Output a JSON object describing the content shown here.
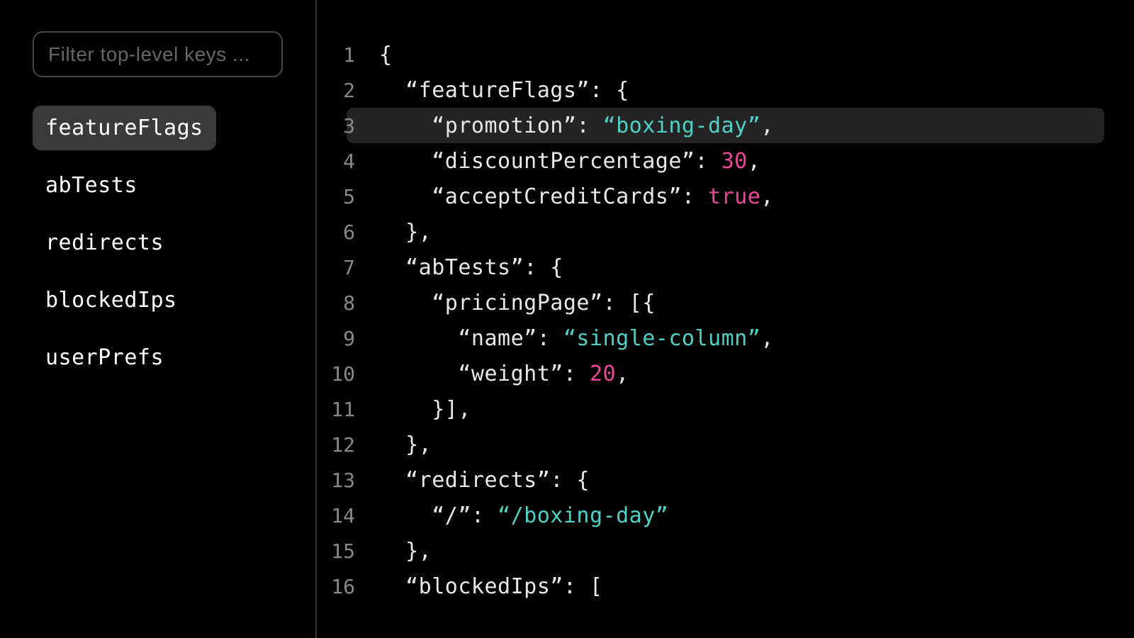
{
  "sidebar": {
    "filter_placeholder": "Filter top-level keys ...",
    "items": [
      {
        "label": "featureFlags",
        "active": true
      },
      {
        "label": "abTests",
        "active": false
      },
      {
        "label": "redirects",
        "active": false
      },
      {
        "label": "blockedIps",
        "active": false
      },
      {
        "label": "userPrefs",
        "active": false
      }
    ]
  },
  "editor": {
    "highlighted_line": 3,
    "lines": [
      {
        "n": 1,
        "indent": 0,
        "tokens": [
          {
            "t": "punc",
            "v": "{"
          }
        ]
      },
      {
        "n": 2,
        "indent": 1,
        "tokens": [
          {
            "t": "key",
            "v": "“featureFlags”"
          },
          {
            "t": "punc",
            "v": ": {"
          }
        ]
      },
      {
        "n": 3,
        "indent": 2,
        "tokens": [
          {
            "t": "key",
            "v": "“promotion”"
          },
          {
            "t": "punc",
            "v": ": "
          },
          {
            "t": "string",
            "v": "“boxing-day”"
          },
          {
            "t": "punc",
            "v": ","
          }
        ]
      },
      {
        "n": 4,
        "indent": 2,
        "tokens": [
          {
            "t": "key",
            "v": "“discountPercentage”"
          },
          {
            "t": "punc",
            "v": ": "
          },
          {
            "t": "number",
            "v": "30"
          },
          {
            "t": "punc",
            "v": ","
          }
        ]
      },
      {
        "n": 5,
        "indent": 2,
        "tokens": [
          {
            "t": "key",
            "v": "“acceptCreditCards”"
          },
          {
            "t": "punc",
            "v": ": "
          },
          {
            "t": "bool",
            "v": "true"
          },
          {
            "t": "punc",
            "v": ","
          }
        ]
      },
      {
        "n": 6,
        "indent": 1,
        "tokens": [
          {
            "t": "punc",
            "v": "},"
          }
        ]
      },
      {
        "n": 7,
        "indent": 1,
        "tokens": [
          {
            "t": "key",
            "v": "“abTests”"
          },
          {
            "t": "punc",
            "v": ": {"
          }
        ]
      },
      {
        "n": 8,
        "indent": 2,
        "tokens": [
          {
            "t": "key",
            "v": "“pricingPage”"
          },
          {
            "t": "punc",
            "v": ": [{"
          }
        ]
      },
      {
        "n": 9,
        "indent": 3,
        "tokens": [
          {
            "t": "key",
            "v": "“name”"
          },
          {
            "t": "punc",
            "v": ": "
          },
          {
            "t": "string",
            "v": "“single-column”"
          },
          {
            "t": "punc",
            "v": ","
          }
        ]
      },
      {
        "n": 10,
        "indent": 3,
        "tokens": [
          {
            "t": "key",
            "v": "“weight”"
          },
          {
            "t": "punc",
            "v": ": "
          },
          {
            "t": "number",
            "v": "20"
          },
          {
            "t": "punc",
            "v": ","
          }
        ]
      },
      {
        "n": 11,
        "indent": 2,
        "tokens": [
          {
            "t": "punc",
            "v": "}],"
          }
        ]
      },
      {
        "n": 12,
        "indent": 1,
        "tokens": [
          {
            "t": "punc",
            "v": "},"
          }
        ]
      },
      {
        "n": 13,
        "indent": 1,
        "tokens": [
          {
            "t": "key",
            "v": "“redirects”"
          },
          {
            "t": "punc",
            "v": ": {"
          }
        ]
      },
      {
        "n": 14,
        "indent": 2,
        "tokens": [
          {
            "t": "key",
            "v": "“/”"
          },
          {
            "t": "punc",
            "v": ": "
          },
          {
            "t": "string",
            "v": "“/boxing-day”"
          }
        ]
      },
      {
        "n": 15,
        "indent": 1,
        "tokens": [
          {
            "t": "punc",
            "v": "},"
          }
        ]
      },
      {
        "n": 16,
        "indent": 1,
        "tokens": [
          {
            "t": "key",
            "v": "“blockedIps”"
          },
          {
            "t": "punc",
            "v": ": ["
          }
        ]
      }
    ]
  },
  "colors": {
    "background": "#000000",
    "foreground": "#e8e8e8",
    "string": "#4fd1c5",
    "number": "#ec4899",
    "boolean": "#ec4899",
    "highlight": "#242424",
    "border": "#333333",
    "input_border": "#444444",
    "placeholder": "#666666",
    "gutter": "#888888",
    "nav_active_bg": "#3a3a3a"
  }
}
